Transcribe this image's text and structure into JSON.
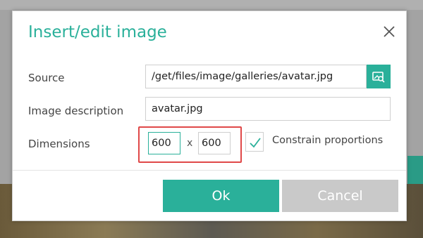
{
  "dialog": {
    "title": "Insert/edit image",
    "close_icon": "close-icon"
  },
  "form": {
    "source_label": "Source",
    "source_value": "/get/files/image/galleries/avatar.jpg",
    "browse_icon": "browse-image-icon",
    "description_label": "Image description",
    "description_value": "avatar.jpg",
    "dimensions_label": "Dimensions",
    "width_value": "600",
    "separator": "x",
    "height_value": "600",
    "constrain_label": "Constrain proportions",
    "constrain_checked": true
  },
  "buttons": {
    "ok_label": "Ok",
    "cancel_label": "Cancel"
  },
  "colors": {
    "accent": "#2ab09a",
    "highlight": "#e04848",
    "cancel": "#c9c9c9"
  }
}
